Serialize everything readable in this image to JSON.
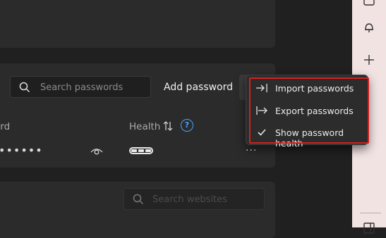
{
  "search": {
    "placeholder": "Search passwords"
  },
  "toolbar": {
    "add_label": "Add password"
  },
  "table": {
    "col_password_partial": "ord",
    "col_health": "Health",
    "help": "?"
  },
  "row": {
    "masked_password": "••••••",
    "more": "···"
  },
  "search_sites": {
    "placeholder": "Search websites"
  },
  "menu": {
    "items": [
      {
        "label": "Import passwords",
        "icon": "import-icon"
      },
      {
        "label": "Export passwords",
        "icon": "export-icon"
      },
      {
        "label": "Show password health",
        "icon": "checkmark-icon",
        "checked": true
      }
    ]
  },
  "colors": {
    "highlight": "#d42020",
    "help": "#4aa3ff",
    "sidebar": "#f2e3e3"
  }
}
